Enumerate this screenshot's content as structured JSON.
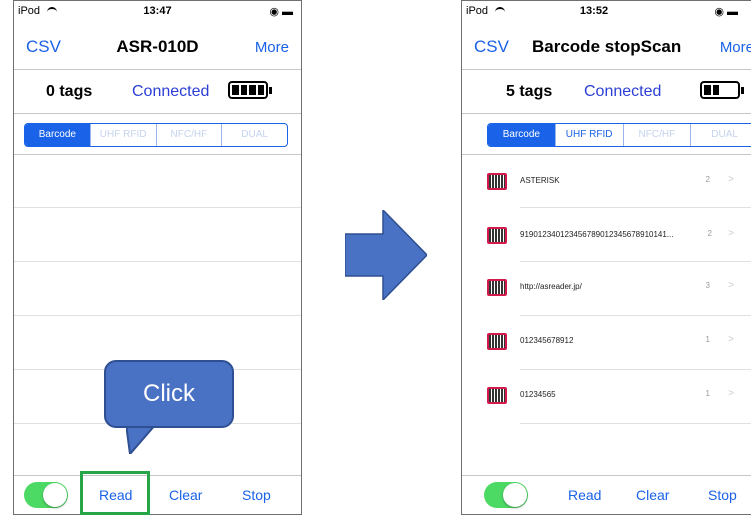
{
  "left_phone": {
    "status": {
      "carrier": "iPod",
      "time": "13:47"
    },
    "nav": {
      "left": "CSV",
      "title": "ASR-010D",
      "right": "More"
    },
    "info": {
      "tags": "0 tags",
      "connection": "Connected"
    },
    "segments": [
      "Barcode",
      "UHF RFID",
      "NFC/HF",
      "DUAL"
    ],
    "toolbar": {
      "read": "Read",
      "clear": "Clear",
      "stop": "Stop"
    }
  },
  "right_phone": {
    "status": {
      "carrier": "iPod",
      "time": "13:52"
    },
    "nav": {
      "left": "CSV",
      "title": "Barcode stopScan",
      "right": "More"
    },
    "info": {
      "tags": "5 tags",
      "connection": "Connected"
    },
    "segments": [
      "Barcode",
      "UHF RFID",
      "NFC/HF",
      "DUAL"
    ],
    "items": [
      {
        "code": "ASTERISK",
        "count": "2"
      },
      {
        "code": "919012340123456789012345678910141...",
        "count": "2"
      },
      {
        "code": "http://asreader.jp/",
        "count": "3"
      },
      {
        "code": "012345678912",
        "count": "1"
      },
      {
        "code": "01234565",
        "count": "1"
      }
    ],
    "toolbar": {
      "read": "Read",
      "clear": "Clear",
      "stop": "Stop"
    }
  },
  "callout": {
    "text": "Click"
  },
  "colors": {
    "accent": "#1a62e8",
    "toggle": "#4cd964",
    "callout": "#4a72c4",
    "highlight": "#27a647",
    "barcode_icon": "#d21b4c"
  }
}
